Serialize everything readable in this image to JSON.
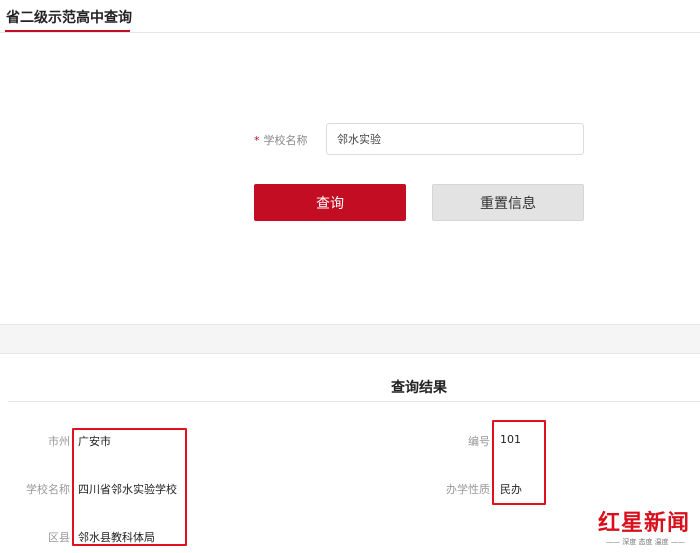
{
  "tab": {
    "title": "省二级示范高中查询"
  },
  "form": {
    "required_mark": "*",
    "school_label": "学校名称",
    "school_value": "邻水实验",
    "query_button": "查询",
    "reset_button": "重置信息"
  },
  "results": {
    "title": "查询结果",
    "fields": {
      "city_label": "市州",
      "city_value": "广安市",
      "number_label": "编号",
      "number_value": "101",
      "school_label": "学校名称",
      "school_value": "四川省邻水实验学校",
      "type_label": "办学性质",
      "type_value": "民办",
      "district_label": "区县",
      "district_value": "邻水县教科体局"
    }
  },
  "watermark": {
    "name": "红星新闻",
    "slogan": "—— 深度 态度 温度 ——"
  },
  "colors": {
    "accent": "#c30d23",
    "annotation": "#e0101e"
  }
}
